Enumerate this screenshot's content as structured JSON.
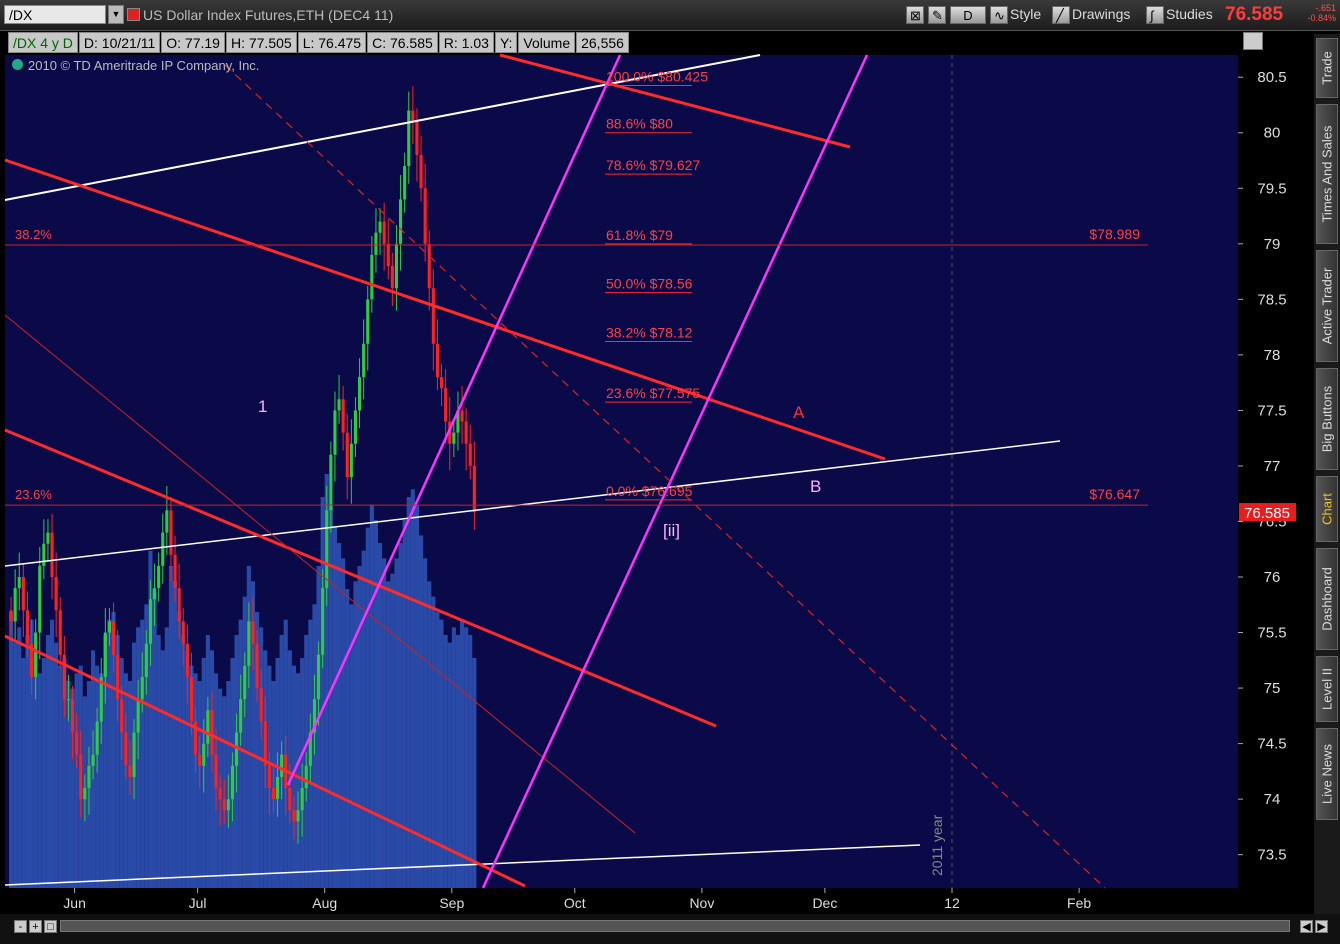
{
  "topbar": {
    "symbol": "/DX",
    "instrument": "US Dollar Index Futures,ETH (DEC4 11)",
    "aggregation": "D",
    "style_label": "Style",
    "drawings_label": "Drawings",
    "studies_label": "Studies",
    "last_price": "76.585",
    "net_change": "-.651",
    "pct_change": "-0.84%"
  },
  "infobar": {
    "title": "/DX 4 y D",
    "date": "D: 10/21/11",
    "open": "O: 77.19",
    "high": "H: 77.505",
    "low": "L: 76.475",
    "close": "C: 76.585",
    "range": "R: 1.03",
    "y": "Y:",
    "volume_label": "Volume",
    "volume": "26,556"
  },
  "copyright": "2010 © TD Ameritrade IP Company, Inc.",
  "side_tabs": [
    "Trade",
    "Times And Sales",
    "Active Trader",
    "Big Buttons",
    "Chart",
    "Dashboard",
    "Level II",
    "Live News"
  ],
  "active_tab": "Chart",
  "chart_data": {
    "type": "candlestick",
    "x_ticks": [
      "Jun",
      "Jul",
      "Aug",
      "Sep",
      "Oct",
      "Nov",
      "Dec",
      "12",
      "Feb"
    ],
    "x_tick_days": [
      16,
      46,
      77,
      108,
      138,
      169,
      199,
      230,
      261
    ],
    "y_ticks": [
      73.5,
      74,
      74.5,
      75,
      75.5,
      76,
      76.5,
      77,
      77.5,
      78,
      78.5,
      79,
      79.5,
      80,
      80.5
    ],
    "ylim": [
      73.2,
      80.7
    ],
    "year_marker": "2011 year",
    "last_price_tag": "76.585",
    "closes": [
      75.6,
      75.9,
      76.0,
      75.7,
      75.4,
      75.1,
      75.5,
      76.1,
      76.3,
      76.4,
      76.0,
      75.7,
      75.3,
      74.9,
      74.9,
      74.6,
      74.4,
      74.0,
      74.1,
      74.3,
      74.4,
      74.7,
      75.1,
      75.5,
      75.6,
      75.3,
      74.9,
      74.6,
      74.3,
      74.2,
      74.6,
      74.9,
      75.1,
      75.4,
      75.8,
      75.9,
      76.1,
      76.4,
      76.6,
      76.2,
      75.9,
      75.6,
      75.4,
      75.1,
      74.7,
      74.4,
      74.3,
      74.5,
      74.8,
      74.4,
      74.1,
      74.0,
      73.9,
      74.0,
      74.3,
      74.6,
      74.9,
      75.2,
      75.6,
      75.4,
      75.0,
      74.7,
      74.3,
      74.1,
      74.0,
      74.2,
      74.4,
      74.1,
      73.9,
      73.8,
      73.9,
      74.1,
      74.3,
      74.6,
      74.9,
      75.3,
      75.9,
      76.6,
      77.1,
      77.5,
      77.6,
      77.3,
      76.9,
      77.2,
      77.5,
      77.8,
      78.1,
      78.5,
      78.9,
      79.1,
      79.2,
      79.0,
      78.8,
      78.6,
      79.0,
      79.4,
      79.7,
      80.2,
      80.1,
      79.8,
      79.5,
      79.0,
      78.6,
      78.1,
      77.8,
      77.7,
      77.4,
      77.2,
      77.3,
      77.5,
      77.4,
      77.2,
      77.0,
      76.585
    ],
    "volumes": [
      36,
      32,
      34,
      30,
      33,
      35,
      31,
      28,
      30,
      33,
      35,
      32,
      29,
      30,
      27,
      26,
      28,
      29,
      25,
      27,
      31,
      29,
      28,
      33,
      35,
      36,
      33,
      30,
      28,
      27,
      32,
      34,
      35,
      37,
      44,
      39,
      33,
      31,
      34,
      42,
      40,
      36,
      33,
      31,
      29,
      28,
      27,
      30,
      33,
      31,
      28,
      26,
      25,
      27,
      30,
      33,
      35,
      38,
      42,
      40,
      36,
      34,
      31,
      29,
      27,
      30,
      33,
      35,
      31,
      29,
      28,
      30,
      33,
      35,
      37,
      42,
      51,
      54,
      50,
      47,
      45,
      43,
      39,
      37,
      40,
      42,
      44,
      47,
      50,
      48,
      45,
      43,
      40,
      41,
      43,
      45,
      48,
      51,
      52,
      50,
      46,
      43,
      40,
      38,
      36,
      35,
      33,
      32,
      34,
      33,
      35,
      34,
      33,
      30
    ],
    "volume_range": [
      0,
      60
    ],
    "overlays": [
      {
        "kind": "hline",
        "label": "38.2%",
        "value_label": "$78.989",
        "price": 78.989
      },
      {
        "kind": "hline",
        "label": "23.6%",
        "value_label": "$76.647",
        "price": 76.647
      }
    ],
    "fib_levels": [
      {
        "pct": "100.0%",
        "price": "$80.425",
        "level": 80.425
      },
      {
        "pct": "88.6%",
        "price": "$80",
        "level": 80.0
      },
      {
        "pct": "78.6%",
        "price": "$79.627",
        "level": 79.627
      },
      {
        "pct": "61.8%",
        "price": "$79",
        "level": 79.0
      },
      {
        "pct": "50.0%",
        "price": "$78.56",
        "level": 78.56
      },
      {
        "pct": "38.2%",
        "price": "$78.12",
        "level": 78.12
      },
      {
        "pct": "23.6%",
        "price": "$77.575",
        "level": 77.575
      },
      {
        "pct": "0.0%",
        "price": "$76.695",
        "level": 76.695
      }
    ],
    "annotations": [
      "1",
      "A",
      "B",
      "[ii]"
    ]
  }
}
